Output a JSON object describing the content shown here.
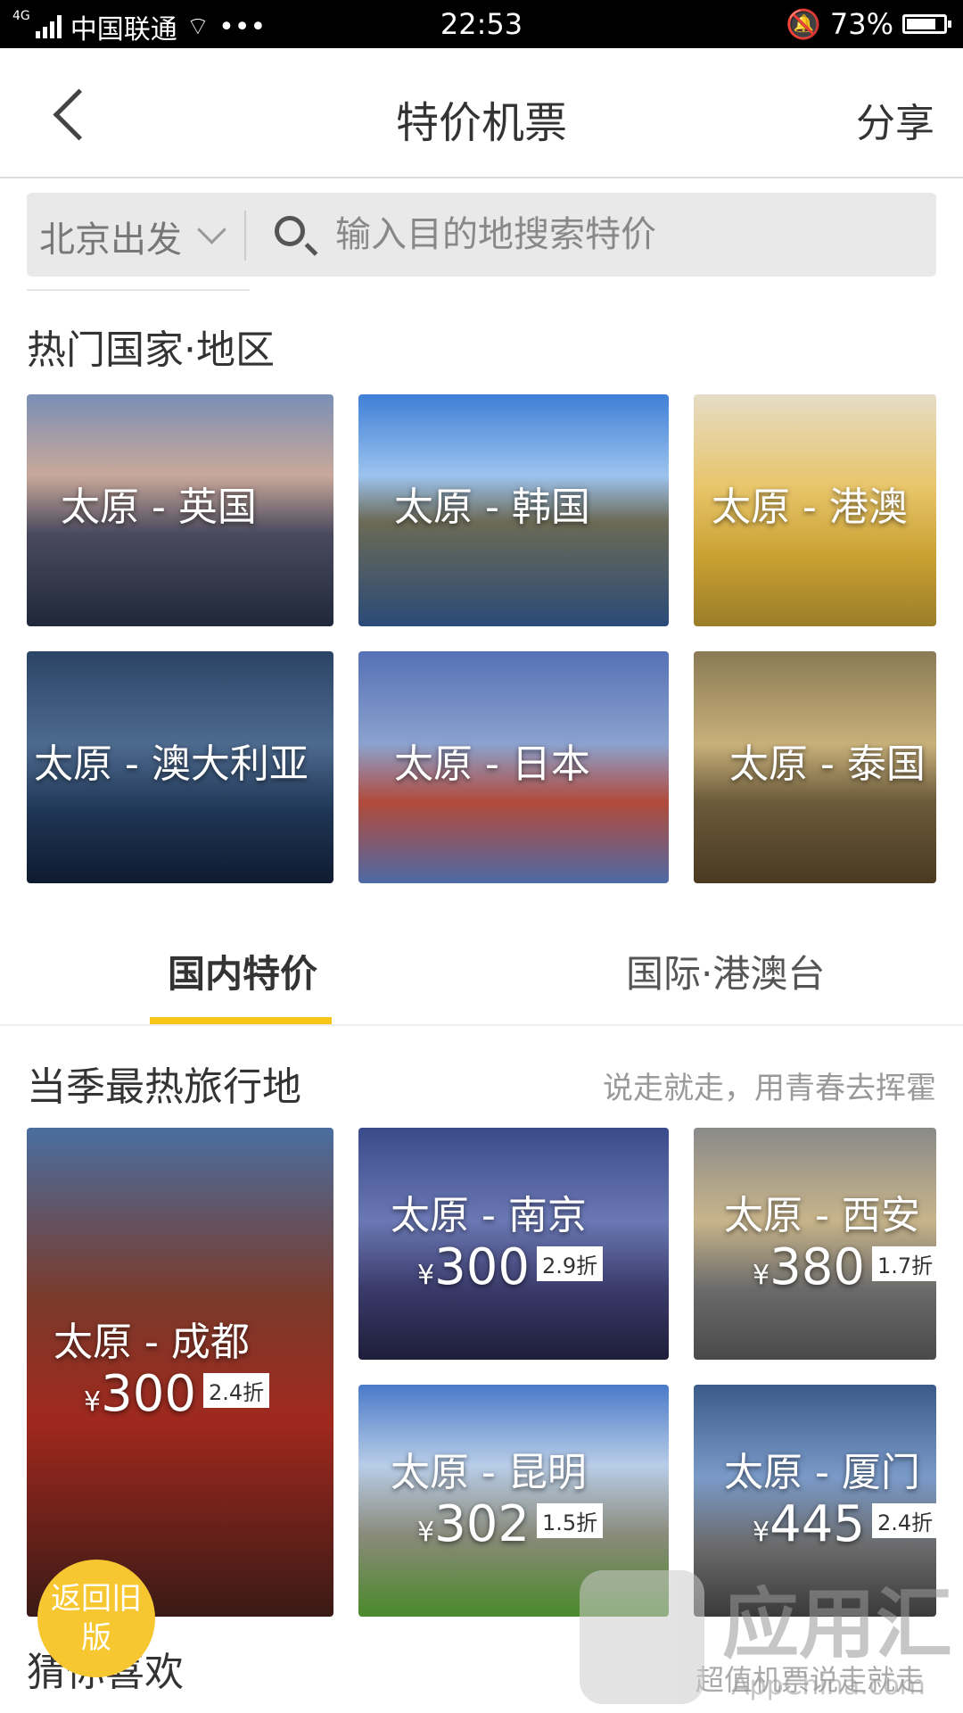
{
  "status_bar": {
    "network": "4G",
    "carrier": "中国联通",
    "dots": "•••",
    "time": "22:53",
    "battery": "73%",
    "battery_level": 0.73
  },
  "nav": {
    "title": "特价机票",
    "share": "分享"
  },
  "search": {
    "departure": "北京出发",
    "placeholder": "输入目的地搜索特价"
  },
  "hot_regions": {
    "title": "热门国家·地区",
    "items": [
      {
        "label": "太原 - 英国"
      },
      {
        "label": "太原 - 韩国"
      },
      {
        "label": "太原 - 港澳"
      },
      {
        "label": "太原 - 澳大利亚"
      },
      {
        "label": "太原 - 日本"
      },
      {
        "label": "太原 - 泰国"
      }
    ]
  },
  "tabs": [
    {
      "label": "国内特价"
    },
    {
      "label": "国际·港澳台"
    }
  ],
  "season": {
    "title": "当季最热旅行地",
    "subtitle": "说走就走，用青春去挥霍",
    "items": [
      {
        "route": "太原 - 成都",
        "currency": "¥",
        "price": "300",
        "discount": "2.4折"
      },
      {
        "route": "太原 - 南京",
        "currency": "¥",
        "price": "300",
        "discount": "2.9折"
      },
      {
        "route": "太原 - 西安",
        "currency": "¥",
        "price": "380",
        "discount": "1.7折"
      },
      {
        "route": "太原 - 昆明",
        "currency": "¥",
        "price": "302",
        "discount": "1.5折"
      },
      {
        "route": "太原 - 厦门",
        "currency": "¥",
        "price": "445",
        "discount": "2.4折"
      }
    ]
  },
  "bottom": {
    "guess_title": "猜你喜欢",
    "old_version_button": "返回旧版",
    "slogan": "超值机票说走就走"
  },
  "watermark": {
    "text": "应用汇",
    "sub": "AppChina.com"
  }
}
